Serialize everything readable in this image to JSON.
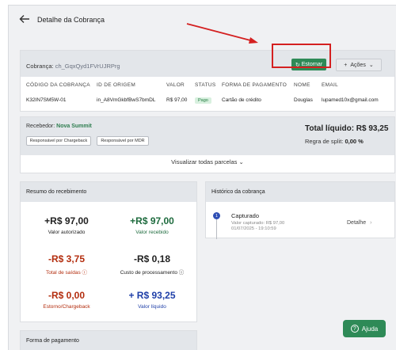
{
  "header": {
    "title": "Detalhe da Cobrança"
  },
  "charge": {
    "label": "Cobrança:",
    "id": "ch_GqxQyd1FVrUJRPrg",
    "refund_button": "Estornar",
    "actions_button": "Ações"
  },
  "table": {
    "columns": [
      "CÓDIGO DA COBRANÇA",
      "ID DE ORIGEM",
      "VALOR",
      "STATUS",
      "FORMA DE PAGAMENTO",
      "NOME",
      "EMAIL"
    ],
    "row": {
      "code": "K32IN7SM5W-01",
      "origin_id": "in_A8VmGkbfBwS7bmDL",
      "value": "R$ 97,00",
      "status": "Pago",
      "payment_method": "Cartão de crédito",
      "name": "Douglas",
      "email": "lupamed10x@gmail.com"
    }
  },
  "receiver": {
    "label": "Recebedor:",
    "name": "Nova Summit",
    "chip_chargeback": "Responsável por Chargeback",
    "chip_mdr": "Responsável por MDR",
    "total": "Total líquido: R$ 93,25",
    "split_label": "Regra de split:",
    "split_value": "0,00 %",
    "view_all": "Visualizar todas parcelas"
  },
  "summary": {
    "title": "Resumo do recebimento",
    "authorized_value": "+R$ 97,00",
    "authorized_label": "Valor autorizado",
    "received_value": "+R$ 97,00",
    "received_label": "Valor recebido",
    "outflows_value": "-R$ 3,75",
    "outflows_label": "Total de saídas",
    "processing_value": "-R$ 0,18",
    "processing_label": "Custo de processamento",
    "chargeback_value": "-R$ 0,00",
    "chargeback_label": "Estorno/Chargeback",
    "net_value": "+ R$ 93,25",
    "net_label": "Valor líquido"
  },
  "history": {
    "title": "Histórico da cobrança",
    "step": "1",
    "event_title": "Capturado",
    "event_value": "Valor capturado: R$ 97,00",
    "event_date": "01/07/2025 - 19:10:59",
    "detail_link": "Detalhe"
  },
  "payment": {
    "title": "Forma de pagamento"
  },
  "help": {
    "label": "Ajuda"
  },
  "colors": {
    "accent_green": "#2e8a57",
    "negative_red": "#b32d0e",
    "net_blue": "#1f3fa8",
    "highlight_red": "#d42020"
  }
}
